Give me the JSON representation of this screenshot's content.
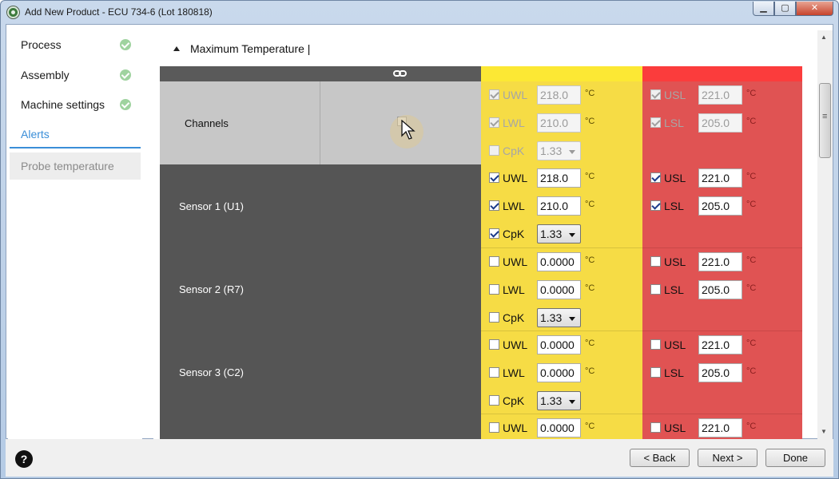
{
  "window": {
    "title": "Add New Product - ECU 734-6 (Lot 180818)",
    "controls": {
      "minimize": "▁",
      "maximize": "▢",
      "close": "✕"
    }
  },
  "sidebar": {
    "steps": [
      {
        "label": "Process",
        "done": true
      },
      {
        "label": "Assembly",
        "done": true
      },
      {
        "label": "Machine settings",
        "done": true
      },
      {
        "label": "Alerts",
        "done": false,
        "active": true
      }
    ],
    "substep": "Probe temperature"
  },
  "section": {
    "title": "Maximum Temperature |",
    "expand_icon": "triangle-up-icon",
    "link_icon": "link-icon"
  },
  "colors": {
    "warning": "#f6dc45",
    "limit": "#e05353",
    "channel_bg": "#c7c7c7",
    "sensor_bg": "#555555",
    "accent": "#3a8ed8"
  },
  "unit": "°C",
  "rows": [
    {
      "name": "Channels",
      "warning": {
        "uwl": {
          "label": "UWL",
          "checked": true,
          "value": "218.0",
          "disabled": true
        },
        "lwl": {
          "label": "LWL",
          "checked": true,
          "value": "210.0",
          "disabled": true
        },
        "cpk": {
          "label": "CpK",
          "checked": false,
          "value": "1.33",
          "disabled": true
        }
      },
      "limit": {
        "usl": {
          "label": "USL",
          "checked": true,
          "value": "221.0",
          "disabled": true
        },
        "lsl": {
          "label": "LSL",
          "checked": true,
          "value": "205.0",
          "disabled": true
        }
      }
    },
    {
      "name": "Sensor 1 (U1)",
      "warning": {
        "uwl": {
          "label": "UWL",
          "checked": true,
          "value": "218.0"
        },
        "lwl": {
          "label": "LWL",
          "checked": true,
          "value": "210.0"
        },
        "cpk": {
          "label": "CpK",
          "checked": true,
          "value": "1.33"
        }
      },
      "limit": {
        "usl": {
          "label": "USL",
          "checked": true,
          "value": "221.0"
        },
        "lsl": {
          "label": "LSL",
          "checked": true,
          "value": "205.0"
        }
      }
    },
    {
      "name": "Sensor 2 (R7)",
      "warning": {
        "uwl": {
          "label": "UWL",
          "checked": false,
          "value": "0.0000"
        },
        "lwl": {
          "label": "LWL",
          "checked": false,
          "value": "0.0000"
        },
        "cpk": {
          "label": "CpK",
          "checked": false,
          "value": "1.33"
        }
      },
      "limit": {
        "usl": {
          "label": "USL",
          "checked": false,
          "value": "221.0"
        },
        "lsl": {
          "label": "LSL",
          "checked": false,
          "value": "205.0"
        }
      }
    },
    {
      "name": "Sensor 3 (C2)",
      "warning": {
        "uwl": {
          "label": "UWL",
          "checked": false,
          "value": "0.0000"
        },
        "lwl": {
          "label": "LWL",
          "checked": false,
          "value": "0.0000"
        },
        "cpk": {
          "label": "CpK",
          "checked": false,
          "value": "1.33"
        }
      },
      "limit": {
        "usl": {
          "label": "USL",
          "checked": false,
          "value": "221.0"
        },
        "lsl": {
          "label": "LSL",
          "checked": false,
          "value": "205.0"
        }
      }
    },
    {
      "name": "",
      "warning": {
        "uwl": {
          "label": "UWL",
          "checked": false,
          "value": "0.0000"
        }
      },
      "limit": {
        "usl": {
          "label": "USL",
          "checked": false,
          "value": "221.0"
        }
      }
    }
  ],
  "footer": {
    "help": "?",
    "back": "< Back",
    "next": "Next >",
    "done": "Done"
  },
  "scrollbar": {
    "up": "▲",
    "down": "▼",
    "grip_icon": "grip-lines-icon"
  }
}
